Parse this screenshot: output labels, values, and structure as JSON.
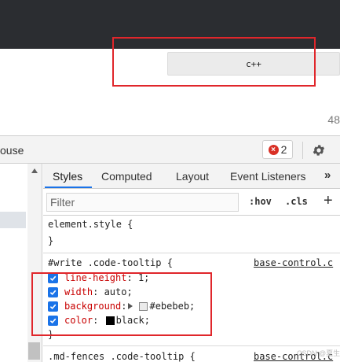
{
  "page": {
    "tooltip_text": "c++",
    "line_number": "48"
  },
  "devtools": {
    "left_cutoff_text": "ouse",
    "error_count": "2",
    "tabs": [
      {
        "label": "Styles",
        "active": true
      },
      {
        "label": "Computed",
        "active": false
      },
      {
        "label": "Layout",
        "active": false
      },
      {
        "label": "Event Listeners",
        "active": false
      }
    ],
    "more_tabs_label": "»",
    "filter_placeholder": "Filter",
    "hov_label": ":hov",
    "cls_label": ".cls",
    "add_label": "+"
  },
  "styles": {
    "element_style": {
      "selector": "element.style {",
      "close": "}"
    },
    "write_rule": {
      "selector": "#write .code-tooltip {",
      "source": "base-control.c",
      "declarations": [
        {
          "prop": "line-height",
          "value": "1;"
        },
        {
          "prop": "width",
          "value": "auto;"
        },
        {
          "prop": "background",
          "value": "#ebebeb;",
          "swatch": "#ebebeb"
        },
        {
          "prop": "color",
          "value": "black;",
          "swatch": "#000000"
        }
      ],
      "close": "}"
    },
    "fences_rule": {
      "selector": ".md-fences .code-tooltip {",
      "source": "base-control.c"
    }
  },
  "watermark": "CSDN @夏生文博",
  "colors": {
    "accent": "#1a73e8",
    "property_red": "#c80000",
    "annotation_red": "#e0262b",
    "tooltip_bg": "#ebebeb",
    "dark_bar": "#2b2d31"
  },
  "icons": {
    "error": "error-circle-icon",
    "settings": "gear-icon",
    "checkbox": "check-icon"
  }
}
